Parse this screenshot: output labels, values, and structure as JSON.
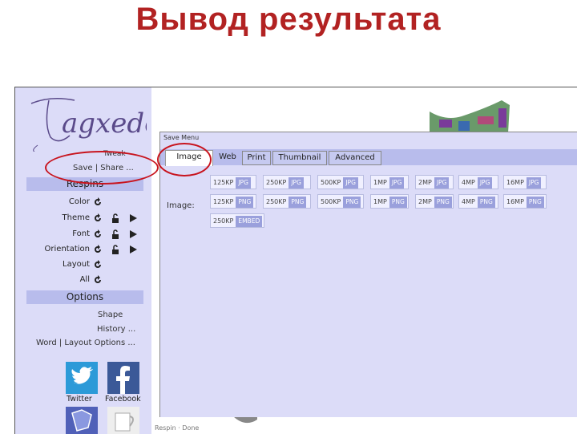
{
  "slide": {
    "title": "Вывод результата"
  },
  "sidebar": {
    "logo_text": "Tagxedo",
    "top_link_partial": "Tweak",
    "save_share": "Save | Share ...",
    "respins_header": "Respins",
    "options": [
      {
        "label": "Color"
      },
      {
        "label": "Theme"
      },
      {
        "label": "Font"
      },
      {
        "label": "Orientation"
      },
      {
        "label": "Layout"
      },
      {
        "label": "All"
      }
    ],
    "options_header": "Options",
    "shape": "Shape",
    "history": "History ...",
    "word_layout": "Word | Layout Options ...",
    "social": [
      {
        "label": "Twitter",
        "color": "#2c9ad8"
      },
      {
        "label": "Facebook",
        "color": "#3b5998"
      }
    ]
  },
  "save_menu": {
    "title": "Save Menu",
    "tabs": [
      "Image",
      "Web",
      "Print",
      "Thumbnail",
      "Advanced"
    ],
    "active_tab": "Image",
    "image_label": "Image:",
    "jpg_row": [
      {
        "size": "125KP",
        "format": "JPG"
      },
      {
        "size": "250KP",
        "format": "JPG"
      },
      {
        "size": "500KP",
        "format": "JPG"
      },
      {
        "size": "1MP",
        "format": "JPG"
      },
      {
        "size": "2MP",
        "format": "JPG"
      },
      {
        "size": "4MP",
        "format": "JPG"
      },
      {
        "size": "16MP",
        "format": "JPG"
      }
    ],
    "png_row": [
      {
        "size": "125KP",
        "format": "PNG"
      },
      {
        "size": "250KP",
        "format": "PNG"
      },
      {
        "size": "500KP",
        "format": "PNG"
      },
      {
        "size": "1MP",
        "format": "PNG"
      },
      {
        "size": "2MP",
        "format": "PNG"
      },
      {
        "size": "4MP",
        "format": "PNG"
      },
      {
        "size": "16MP",
        "format": "PNG"
      }
    ],
    "extra_row": [
      {
        "size": "250KP",
        "format": "EMBED"
      }
    ]
  },
  "status_bar": "Respin · Done",
  "colors": {
    "title": "#b22222",
    "sidebar_bg": "#dcdcf8",
    "header_bg": "#b8bcec",
    "highlight": "#c8141e"
  }
}
